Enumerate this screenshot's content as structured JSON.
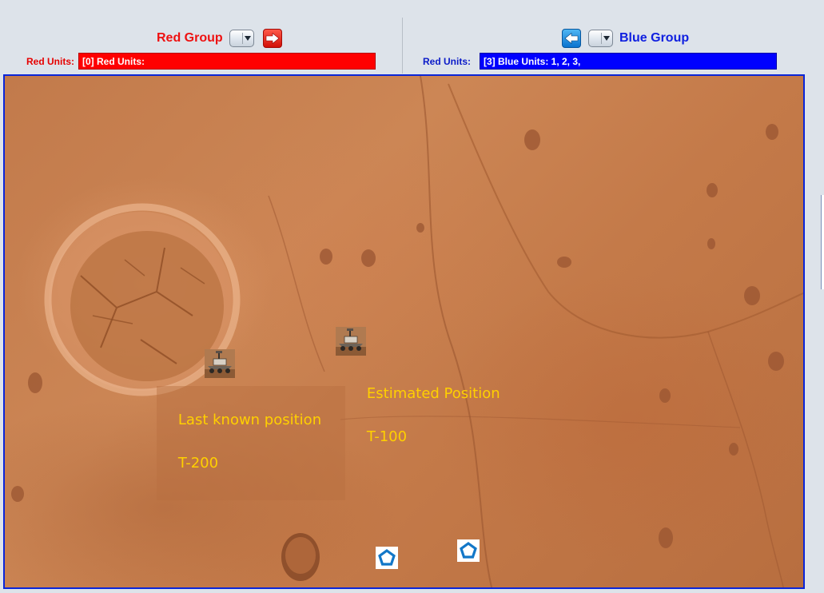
{
  "red_group": {
    "title": "Red Group",
    "units_label": "Red Units:",
    "units_value": "[0] Red Units:",
    "next_button": "right-arrow-icon",
    "color": "#ff0000"
  },
  "blue_group": {
    "title": "Blue Group",
    "units_label": "Red Units:",
    "units_value": "[3] Blue Units: 1, 2, 3,",
    "prev_button": "left-arrow-icon",
    "color": "#0000ff"
  },
  "map": {
    "terrain": "mars-surface",
    "annotations": [
      {
        "line1": "Last known position",
        "line2": "T-200"
      },
      {
        "line1": "Estimated Position",
        "line2": "T-100"
      }
    ],
    "unit_marker_icon": "pentagon-icon"
  }
}
